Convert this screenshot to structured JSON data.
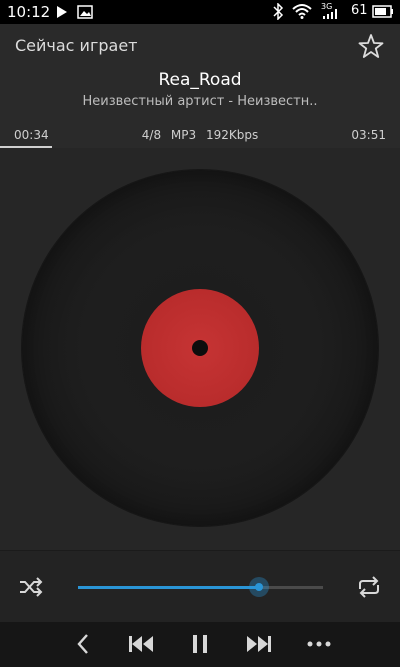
{
  "status_bar": {
    "time": "10:12",
    "network": "3G",
    "battery": "61"
  },
  "header": {
    "title": "Сейчас играет"
  },
  "track": {
    "title": "Rea_Road",
    "subtitle": "Неизвестный артист - Неизвестн.."
  },
  "meta": {
    "elapsed": "00:34",
    "position": "4/8",
    "format": "MP3",
    "bitrate": "192Kbps",
    "duration": "03:51"
  },
  "playback": {
    "seek_fraction": 0.74,
    "accent_color": "#2a95d6",
    "label_color": "#c63434"
  },
  "icons": [
    "play-indicator-icon",
    "image-icon",
    "bluetooth-icon",
    "wifi-icon",
    "signal-icon",
    "battery-icon",
    "star-icon",
    "shuffle-icon",
    "repeat-icon",
    "back-icon",
    "previous-icon",
    "pause-icon",
    "next-icon",
    "more-icon"
  ]
}
